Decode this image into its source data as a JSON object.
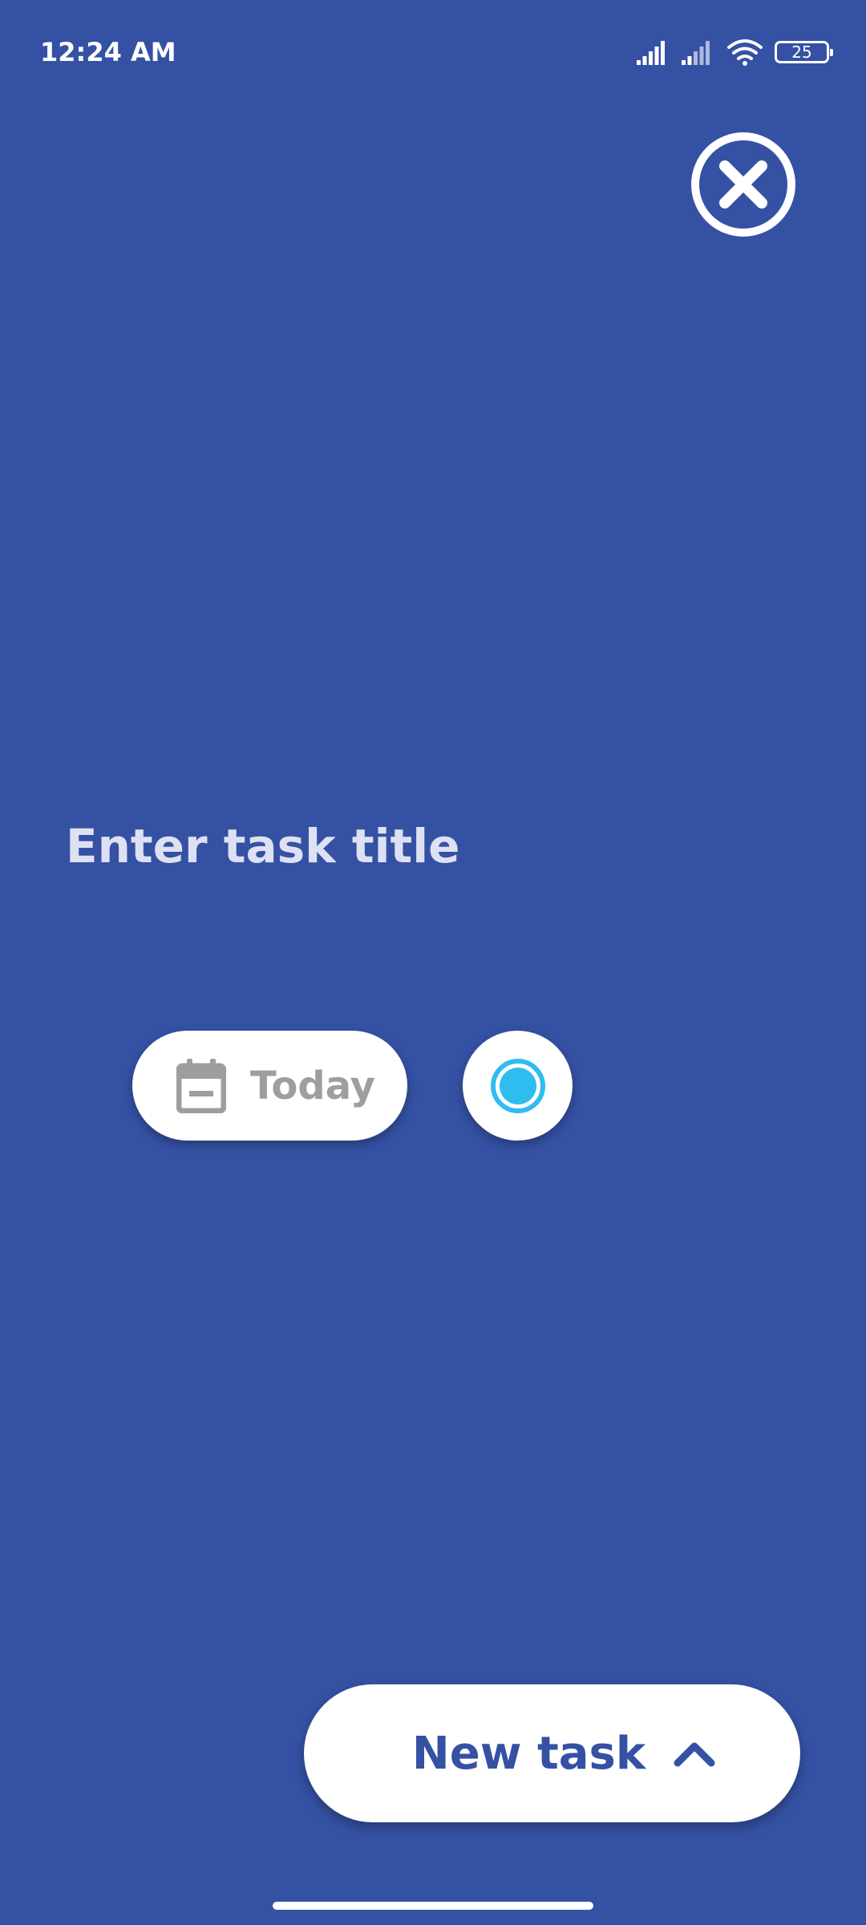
{
  "status_bar": {
    "time": "12:24 AM",
    "battery_level": "25",
    "icons": [
      "signal-icon",
      "signal-icon",
      "wifi-icon",
      "battery-icon"
    ]
  },
  "colors": {
    "background": "#3551a4",
    "accent": "#2fbdf0",
    "chip_text": "#9e9e9e",
    "white": "#ffffff"
  },
  "header": {
    "close_icon": "close-icon"
  },
  "task_form": {
    "title_placeholder": "Enter task title",
    "title_value": "",
    "date_chip": {
      "icon": "calendar-icon",
      "label": "Today"
    },
    "color_picker": {
      "icon": "radio-dot-icon",
      "selected_color": "#2fbdf0"
    }
  },
  "footer": {
    "new_task_label": "New task",
    "new_task_icon": "chevron-up-icon"
  }
}
